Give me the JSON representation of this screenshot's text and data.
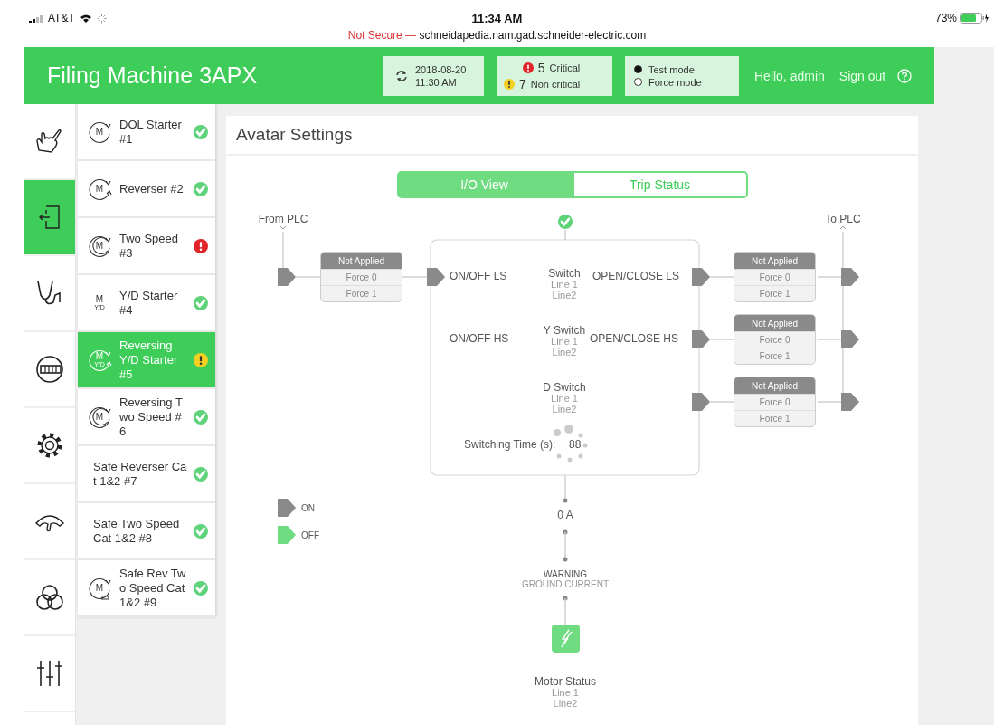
{
  "status_bar": {
    "carrier": "AT&T",
    "time": "11:34 AM",
    "security": "Not Secure —",
    "url": "schneidapedia.nam.gad.schneider-electric.com",
    "battery": "73%"
  },
  "header": {
    "title": "Filing Machine 3APX",
    "sync": {
      "date": "2018-08-20",
      "time": "11:30 AM"
    },
    "alarms": [
      {
        "kind": "critical",
        "count": "5",
        "label": "Critical"
      },
      {
        "kind": "warning",
        "count": "7",
        "label": "Non critical"
      }
    ],
    "modes": [
      {
        "label": "Test mode",
        "selected": true
      },
      {
        "label": "Force mode",
        "selected": false
      }
    ],
    "greeting": "Hello, admin",
    "sign_out": "Sign out"
  },
  "sidebar": {
    "items": [
      {
        "selected": false
      },
      {
        "selected": true
      },
      {
        "selected": false
      },
      {
        "selected": false
      },
      {
        "selected": false
      },
      {
        "selected": false
      },
      {
        "selected": false
      },
      {
        "selected": false
      }
    ]
  },
  "devices": [
    {
      "name": "DOL Starter #1",
      "kind": "single",
      "motor_label": "M",
      "alert": false,
      "color": "#5fd37a",
      "selected": false
    },
    {
      "name": "Reverser #2",
      "kind": "reverser",
      "motor_label": "M",
      "alert": false,
      "color": "#5fd37a",
      "selected": false
    },
    {
      "name": "Two Speed #3",
      "kind": "two_speed",
      "motor_label": "M",
      "alert": true,
      "color": "#e0242a",
      "selected": false
    },
    {
      "name": "Y/D Starter #4",
      "kind": "plain",
      "motor_label": "M",
      "motor_sub": "Y/D",
      "alert": false,
      "color": "#5fd37a",
      "selected": false
    },
    {
      "name": "Reversing Y/D Starter #5",
      "kind": "reverser",
      "motor_label": "M",
      "motor_sub": "Y/D",
      "alert": true,
      "color": "#f5d020",
      "selected": true
    },
    {
      "name": "Reversing Two Speed #6",
      "kind": "two_speed",
      "motor_label": "M",
      "alert": false,
      "color": "#5fd37a",
      "selected": false
    },
    {
      "name": "Safe Reverser Cat 1&2 #7",
      "kind": "none",
      "alert": false,
      "color": "#5fd37a",
      "selected": false
    },
    {
      "name": "Safe Two Speed Cat 1&2 #8",
      "kind": "none",
      "alert": false,
      "color": "#5fd37a",
      "selected": false
    },
    {
      "name": "Safe Rev Two Speed Cat 1&2 #9",
      "kind": "safe",
      "motor_label": "M",
      "alert": false,
      "color": "#5fd37a",
      "selected": false
    }
  ],
  "page_title": "Avatar Settings",
  "view_tabs": [
    {
      "label": "I/O View",
      "selected": true
    },
    {
      "label": "Trip Status",
      "selected": false
    }
  ],
  "diagram": {
    "from_label": "From PLC",
    "to_label": "To PLC",
    "alert": false,
    "inputs": [
      {
        "label": "ON/OFF LS",
        "on": true,
        "force": [
          {
            "label": "Not Applied",
            "selected": true
          },
          {
            "label": "Force 0",
            "selected": false
          },
          {
            "label": "Force 1",
            "selected": false
          }
        ]
      },
      {
        "label": "ON/OFF HS"
      }
    ],
    "switches": [
      {
        "name": "Switch",
        "lines": [
          "Line 1",
          "Line2"
        ]
      },
      {
        "name": "Y Switch",
        "lines": [
          "Line 1",
          "Line2"
        ]
      },
      {
        "name": "D Switch",
        "lines": [
          "Line 1",
          "Line2"
        ]
      }
    ],
    "outputs": [
      {
        "label": "OPEN/CLOSE LS",
        "on": true,
        "force": [
          {
            "label": "Not Applied",
            "selected": true
          },
          {
            "label": "Force 0",
            "selected": false
          },
          {
            "label": "Force 1",
            "selected": false
          }
        ]
      },
      {
        "label": "OPEN/CLOSE HS",
        "on": true,
        "force": [
          {
            "label": "Not Applied",
            "selected": true
          },
          {
            "label": "Force 0",
            "selected": false
          },
          {
            "label": "Force 1",
            "selected": false
          }
        ]
      },
      {
        "on": true,
        "force": [
          {
            "label": "Not Applied",
            "selected": true
          },
          {
            "label": "Force 0",
            "selected": false
          },
          {
            "label": "Force 1",
            "selected": false
          }
        ]
      }
    ],
    "switching_time": {
      "label": "Switching Time (s):",
      "value": "88"
    },
    "current": "0 A",
    "warning": {
      "title": "WARNING",
      "detail": "GROUND CURRENT"
    },
    "motor": {
      "name": "Motor Status",
      "lines": [
        "Line 1",
        "Line2"
      ]
    },
    "legend": [
      {
        "label": "ON",
        "on": true
      },
      {
        "label": "OFF",
        "on": false
      }
    ]
  }
}
